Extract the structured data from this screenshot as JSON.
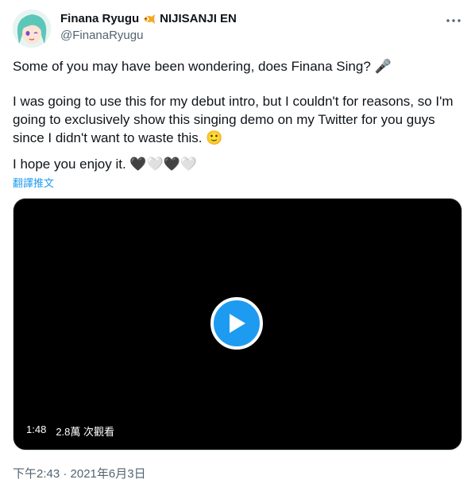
{
  "author": {
    "display_name": "Finana Ryugu",
    "affiliation": "NIJISANJI EN",
    "handle": "@FinanaRyugu",
    "avatar_icon": "vtuber-avatar",
    "badge_icon": "tropical-fish-icon"
  },
  "menu": {
    "more_icon": "more-horizontal-icon"
  },
  "tweet": {
    "line1": "Some of you may have been wondering, does Finana Sing? 🎤",
    "line2": "I was going to use this for my debut intro, but I couldn't for reasons, so I'm going to exclusively show this singing demo on my Twitter for you guys since I didn't want to waste this. 🙂",
    "line3": "I hope you enjoy it. 🖤🤍🖤🤍",
    "translate_label": "翻譯推文"
  },
  "video": {
    "duration": "1:48",
    "views": "2.8萬 次觀看",
    "play_icon": "play-icon"
  },
  "timestamp": "下午2:43 · 2021年6月3日",
  "colors": {
    "accent": "#1d9bf0",
    "text": "#0f1419",
    "muted": "#536471",
    "video_bg": "#000000"
  }
}
